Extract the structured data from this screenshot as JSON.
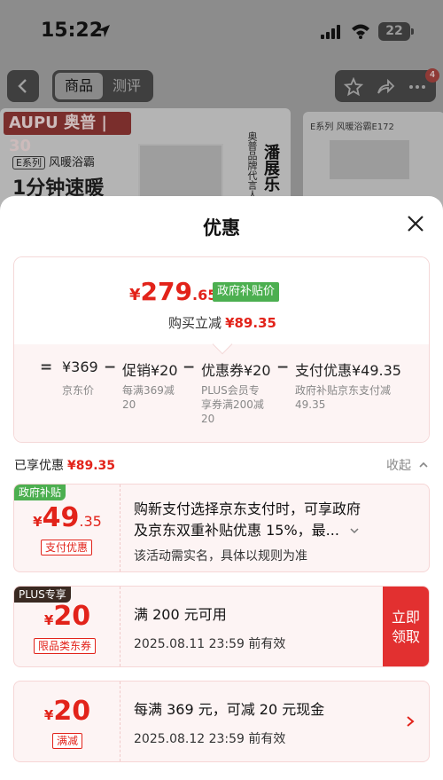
{
  "status_bar": {
    "time": "15:22",
    "battery": "22"
  },
  "nav": {
    "tabs": [
      "商品",
      "测评"
    ],
    "active_tab": "商品",
    "badge": "4"
  },
  "banner": {
    "brand": "AUPU 奥普 | 30",
    "series_tag": "E系列",
    "series_name": "风暖浴霸",
    "slogan": "1分钟速暖",
    "vertical_text": "奥普品牌代言人",
    "vertical_name": "潘展乐",
    "thumb_label": "E系列 风暖浴霸E172"
  },
  "sheet": {
    "title": "优惠",
    "final_price": {
      "currency": "¥",
      "integer": "279",
      "decimal": ".65"
    },
    "gov_tag": "政府补贴价",
    "save_label": "购买立减",
    "save_amount": "¥89.35",
    "calc": {
      "eq": "=",
      "terms": [
        {
          "value": "¥369",
          "sub": "京东价"
        },
        {
          "op": "−",
          "value": "促销¥20",
          "sub": "每满369减\n20"
        },
        {
          "op": "−",
          "value": "优惠券¥20",
          "sub": "PLUS会员专\n享券满200减\n20"
        },
        {
          "op": "−",
          "value": "支付优惠¥49.35",
          "sub": "政府补贴京东支付减\n49.35"
        }
      ]
    },
    "enjoyed_label": "已享优惠",
    "enjoyed_amount": "¥89.35",
    "collapse_label": "收起",
    "coupons": [
      {
        "tag": "政府补贴",
        "tag_color": "#4caf50",
        "currency": "¥",
        "amount": "49",
        "amount_decimal": ".35",
        "label": "支付优惠",
        "text_line1": "购新支付选择京东支付时，可享政府",
        "text_line2": "及京东双重补贴优惠 15%，最...",
        "sub": "该活动需实名，具体以规则为准"
      },
      {
        "tag": "PLUS专享",
        "tag_color": "#3a2a22",
        "currency": "¥",
        "amount": "20",
        "label": "限品类东券",
        "text_line1": "满 200 元可用",
        "sub": "2025.08.11 23:59 前有效",
        "button": "立即\n领取"
      },
      {
        "currency": "¥",
        "amount": "20",
        "label": "满减",
        "text_line1": "每满 369 元，可减 20 元现金",
        "sub": "2025.08.12 23:59 前有效"
      }
    ]
  },
  "colors": {
    "accent_red": "#e2231a",
    "gov_green": "#4caf50",
    "claim_red": "#e23030"
  }
}
